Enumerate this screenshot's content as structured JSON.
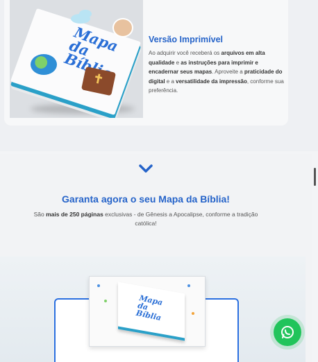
{
  "feature": {
    "title": "Versão Imprimível",
    "text_parts": [
      {
        "t": "Ao adquirir você receberá os ",
        "b": false
      },
      {
        "t": "arquivos em alta qualidade",
        "b": true
      },
      {
        "t": " e ",
        "b": false
      },
      {
        "t": "as instruções para imprimir e encadernar seus mapas",
        "b": true
      },
      {
        "t": ". Aproveite a ",
        "b": false
      },
      {
        "t": "praticidade do digital",
        "b": true
      },
      {
        "t": " e a ",
        "b": false
      },
      {
        "t": "versatilidade da impressão",
        "b": true
      },
      {
        "t": ", conforme sua preferência.",
        "b": false
      }
    ],
    "image": {
      "cover_title": "Mapa da Bíblia",
      "icons": [
        "cloud-icon",
        "globe-icon",
        "bible-icon",
        "cross-icon"
      ]
    }
  },
  "cta": {
    "icon": "chevron-down-icon",
    "title": "Garanta agora o seu Mapa da Bíblia!",
    "subtitle_parts": [
      {
        "t": "São ",
        "b": false
      },
      {
        "t": "mais de 250 páginas",
        "b": true
      },
      {
        "t": " exclusivas - de Gênesis a Apocalipse, conforme a tradição católica!",
        "b": false
      }
    ],
    "mockup": {
      "cover_title": "Mapa da Bíblia"
    }
  },
  "whatsapp": {
    "icon": "whatsapp-icon"
  },
  "colors": {
    "accent": "#2563c9",
    "whatsapp": "#21c45b",
    "text": "#555555"
  }
}
